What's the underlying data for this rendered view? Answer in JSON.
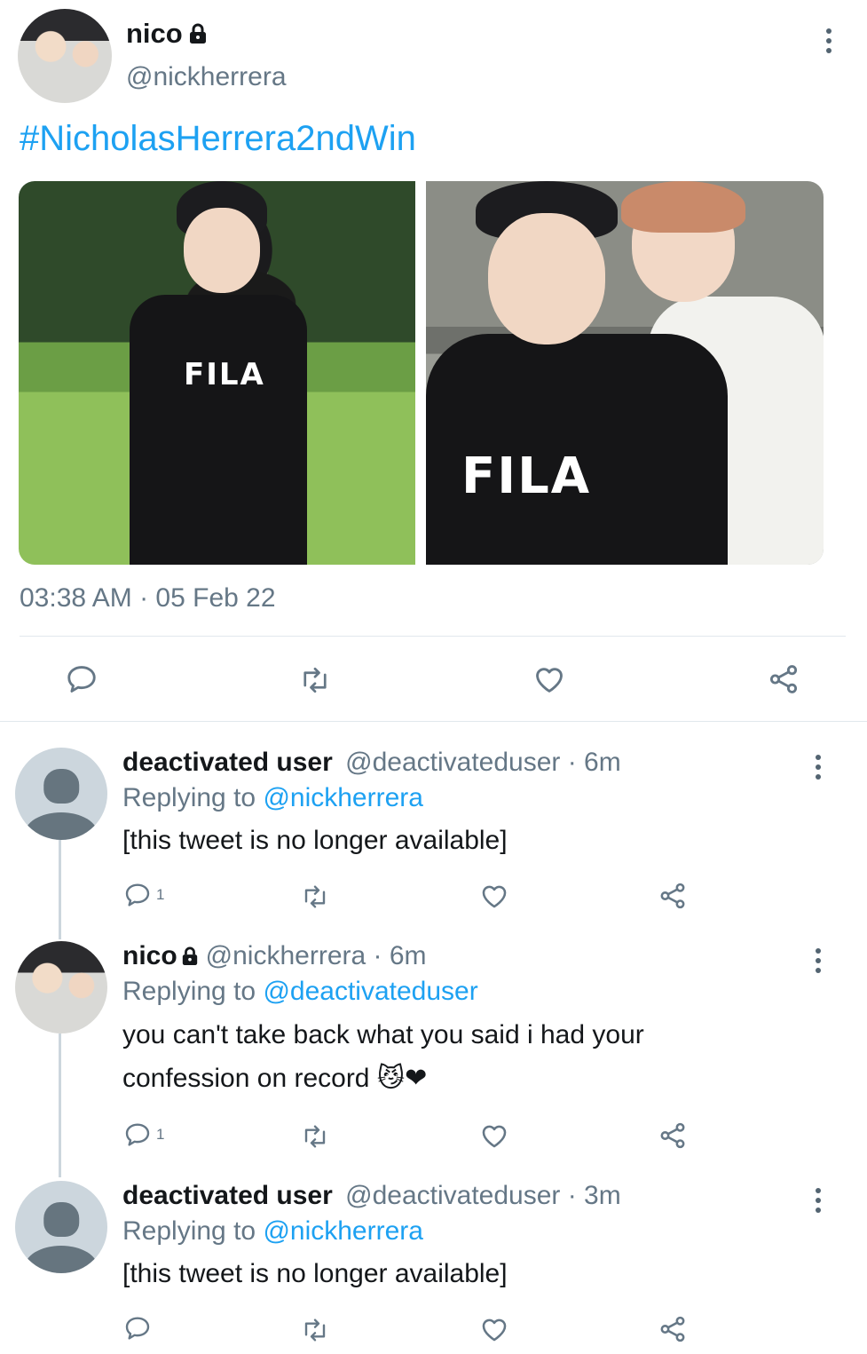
{
  "tweet": {
    "display_name": "nico",
    "handle": "@nickherrera",
    "hashtag": "#NicholasHerrera2ndWin",
    "timestamp": "03:38 AM · 05 Feb 22",
    "photo1_logo_text": "FILA",
    "photo2_logo_text": "FILA"
  },
  "replies": [
    {
      "display_name": "deactivated user",
      "handle_time": "@deactivateduser · 6m",
      "replying_prefix": "Replying to",
      "replying_handle": "@nickherrera",
      "body": "[this tweet is no longer available]",
      "reply_count": "1"
    },
    {
      "display_name": "nico",
      "handle_time": "@nickherrera · 6m",
      "replying_prefix": "Replying to",
      "replying_handle": "@deactivateduser",
      "body_line1": "you can't take back what you said i had your",
      "body_line2": "confession on record 😼❤",
      "reply_count": "1"
    },
    {
      "display_name": "deactivated user",
      "handle_time": "@deactivateduser · 3m",
      "replying_prefix": "Replying to",
      "replying_handle": "@nickherrera",
      "body": "[this tweet is no longer available]",
      "reply_count": ""
    }
  ],
  "colors": {
    "link": "#1da1f2",
    "muted": "#657786",
    "icon": "#657786"
  },
  "icons": [
    "reply-icon",
    "retweet-icon",
    "like-icon",
    "share-icon",
    "lock-icon",
    "more-icon"
  ]
}
